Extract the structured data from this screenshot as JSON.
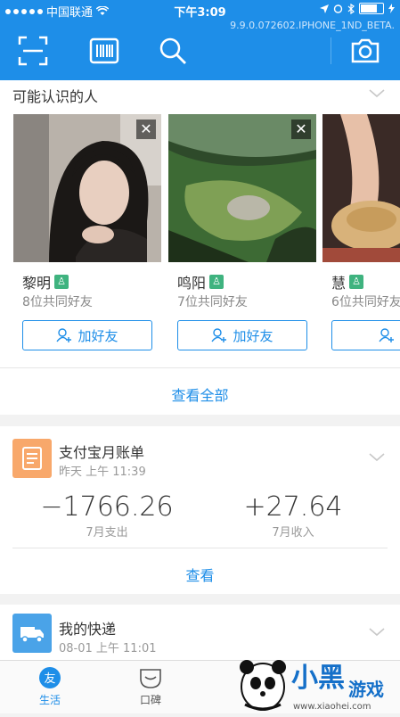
{
  "status": {
    "carrier": "中国联通",
    "time": "下午3:09",
    "version": "9.9.0.072602.IPHONE_1ND_BETA."
  },
  "toolbar": {
    "icons": [
      "scan-icon",
      "barcode-icon",
      "search-icon",
      "camera-icon"
    ]
  },
  "people": {
    "title": "可能认识的人",
    "cards": [
      {
        "name": "黎明",
        "mutual": "8位共同好友",
        "add_label": "加好友"
      },
      {
        "name": "鸣阳",
        "mutual": "7位共同好友",
        "add_label": "加好友"
      },
      {
        "name": "慧",
        "mutual": "6位共同好友",
        "add_label": "加"
      }
    ],
    "view_all": "查看全部"
  },
  "bill": {
    "title": "支付宝月账单",
    "time": "昨天 上午 11:39",
    "expense_value": "−1766.26",
    "expense_label": "7月支出",
    "income_value": "+27.64",
    "income_label": "7月收入",
    "view_label": "查看"
  },
  "delivery": {
    "title": "我的快递",
    "time": "08-01 上午 11:01"
  },
  "tabbar": {
    "tabs": [
      {
        "label": "生活",
        "icon": "life-icon"
      },
      {
        "label": "口碑",
        "icon": "koubei-icon"
      }
    ]
  },
  "watermark": {
    "brand": "小黑游戏",
    "url": "www.xiaohei.com"
  },
  "colors": {
    "accent": "#1e8ee8",
    "bill_icon": "#f8a86b",
    "verified": "#3fb37f"
  }
}
